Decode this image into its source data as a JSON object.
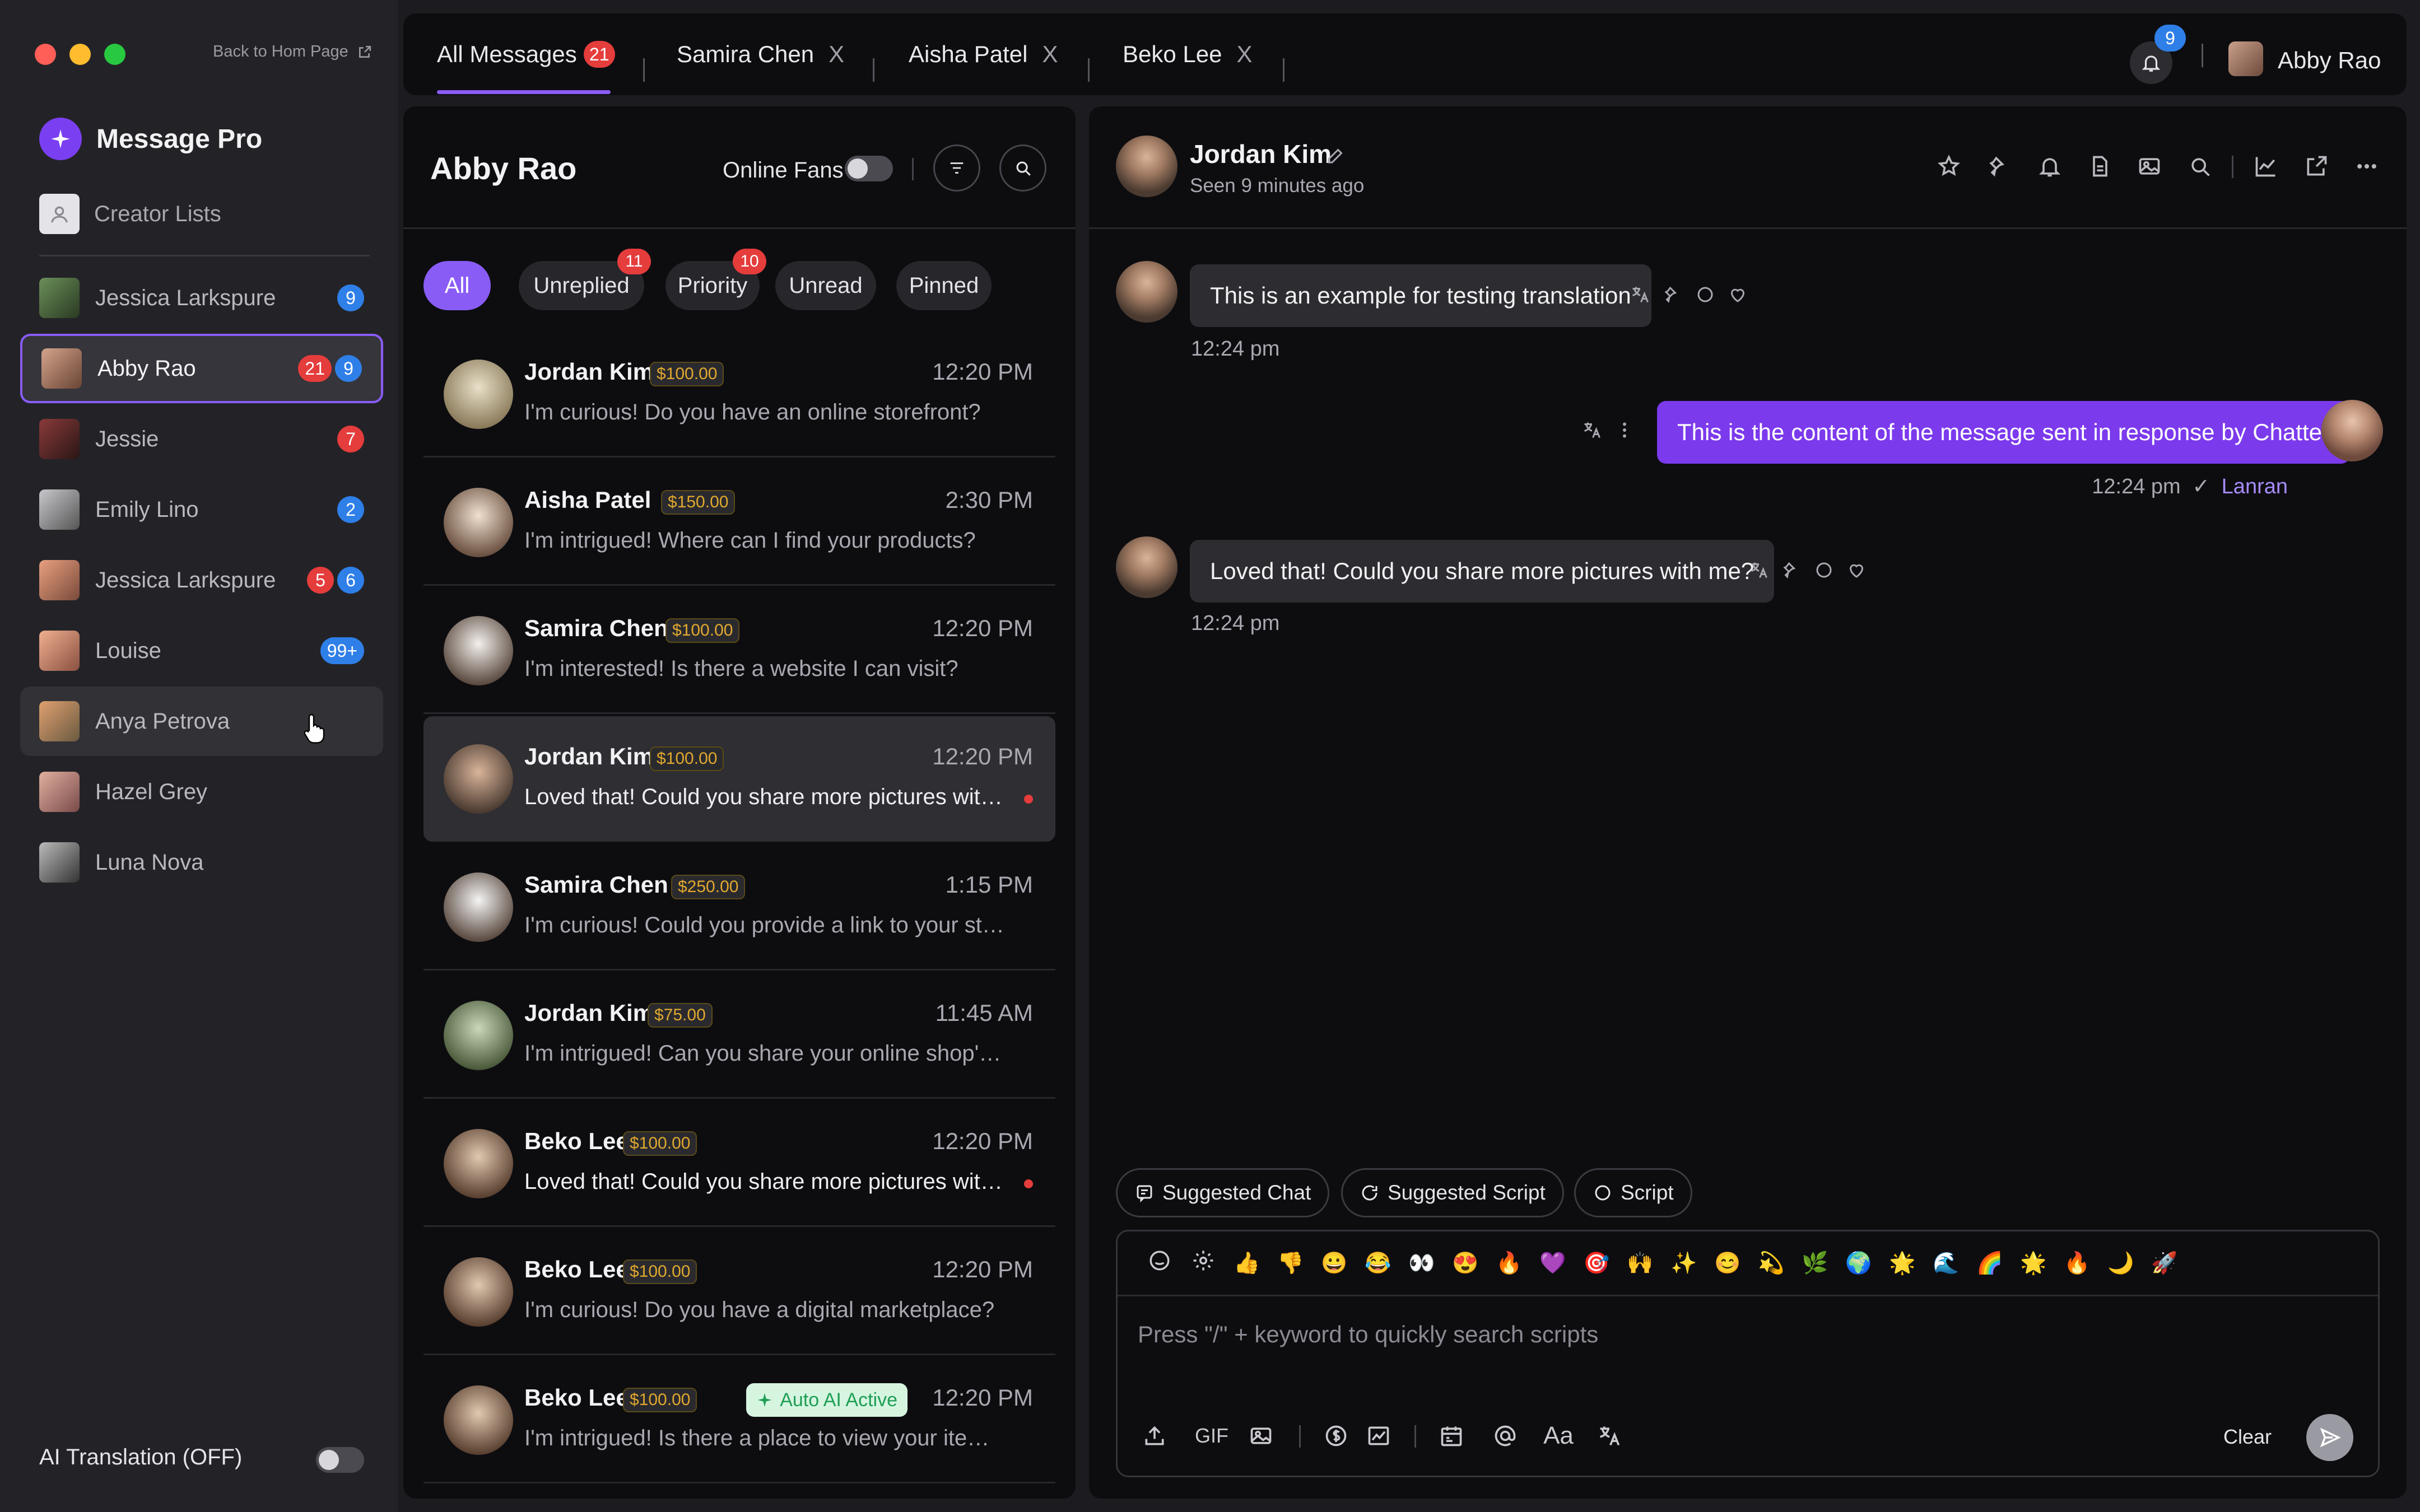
{
  "window": {
    "controls": [
      "close",
      "minimize",
      "maximize"
    ]
  },
  "sidebar": {
    "back_link": "Back to Hom Page",
    "brand": "Message Pro",
    "creator_lists": "Creator Lists",
    "creators": [
      {
        "name": "Jessica Larkspure",
        "badges": [
          {
            "text": "9",
            "color": "blue"
          }
        ]
      },
      {
        "name": "Abby Rao",
        "badges": [
          {
            "text": "21",
            "color": "red"
          },
          {
            "text": "9",
            "color": "blue"
          }
        ],
        "active": true
      },
      {
        "name": "Jessie",
        "badges": [
          {
            "text": "7",
            "color": "red"
          }
        ]
      },
      {
        "name": "Emily Lino",
        "badges": [
          {
            "text": "2",
            "color": "blue"
          }
        ]
      },
      {
        "name": "Jessica Larkspure",
        "badges": [
          {
            "text": "5",
            "color": "red"
          },
          {
            "text": "6",
            "color": "blue"
          }
        ]
      },
      {
        "name": "Louise",
        "badges": [
          {
            "text": "99+",
            "color": "blue"
          }
        ]
      },
      {
        "name": "Anya Petrova",
        "badges": [],
        "hover": true
      },
      {
        "name": "Hazel Grey",
        "badges": []
      },
      {
        "name": "Luna Nova",
        "badges": []
      }
    ],
    "ai_translation": {
      "label": "AI Translation (OFF)",
      "on": false
    }
  },
  "tabs": [
    {
      "label": "All Messages",
      "count": "21",
      "active": true
    },
    {
      "label": "Samira Chen",
      "close": "X"
    },
    {
      "label": "Aisha Patel",
      "close": "X"
    },
    {
      "label": "Beko Lee",
      "close": "X"
    }
  ],
  "notifications": {
    "count": "9"
  },
  "user": {
    "name": "Abby Rao"
  },
  "list": {
    "title": "Abby Rao",
    "online_fans_label": "Online Fans",
    "online_fans_on": false,
    "filters": [
      {
        "label": "All",
        "selected": true
      },
      {
        "label": "Unreplied",
        "count": "11"
      },
      {
        "label": "Priority",
        "count": "10"
      },
      {
        "label": "Unread"
      },
      {
        "label": "Pinned"
      }
    ],
    "conversations": [
      {
        "name": "Jordan Kim",
        "amount": "$100.00",
        "time": "12:20 PM",
        "preview": "I'm curious! Do you have an online storefront?"
      },
      {
        "name": "Aisha Patel",
        "amount": "$150.00",
        "time": "2:30 PM",
        "preview": "I'm intrigued! Where can I find your products?"
      },
      {
        "name": "Samira Chen",
        "amount": "$100.00",
        "time": "12:20 PM",
        "preview": "I'm interested! Is there a website I can visit?"
      },
      {
        "name": "Jordan Kim",
        "amount": "$100.00",
        "time": "12:20 PM",
        "preview": "Loved that! Could you share more pictures with...",
        "unread": true,
        "selected": true
      },
      {
        "name": "Samira Chen",
        "amount": "$250.00",
        "time": "1:15 PM",
        "preview": "I'm curious! Could you provide a link to your store?"
      },
      {
        "name": "Jordan Kim",
        "amount": "$75.00",
        "time": "11:45 AM",
        "preview": "I'm intrigued! Can you share your online shop's UR..."
      },
      {
        "name": "Beko Lee",
        "amount": "$100.00",
        "time": "12:20 PM",
        "preview": "Loved that! Could you share more pictures with...",
        "unread": true
      },
      {
        "name": "Beko Lee",
        "amount": "$100.00",
        "time": "12:20 PM",
        "preview": "I'm curious! Do you have a digital marketplace?"
      },
      {
        "name": "Beko Lee",
        "amount": "$100.00",
        "time": "12:20 PM",
        "preview": "I'm intrigued! Is there a place to view your items?",
        "auto_ai": "Auto AI Active"
      }
    ]
  },
  "chat": {
    "name": "Jordan Kim",
    "seen": "Seen 9 minutes ago",
    "header_icons": [
      "star-icon",
      "pin-icon",
      "bell-icon",
      "document-icon",
      "image-icon",
      "search-icon",
      "chart-icon",
      "external-link-icon",
      "more-icon"
    ],
    "messages": [
      {
        "dir": "in",
        "text": "This is an example for testing translation",
        "time": "12:24 pm"
      },
      {
        "dir": "out",
        "text": "This is the content of the message sent in response by Chatter",
        "time": "12:24 pm",
        "sender": "Lanran",
        "check": "✓"
      },
      {
        "dir": "in",
        "text": "Loved that! Could you share more pictures with me?",
        "time": "12:24 pm"
      }
    ],
    "suggestions": [
      "Suggested Chat",
      "Suggested Script",
      "Script"
    ],
    "emojis": [
      "👍",
      "👎",
      "😀",
      "😂",
      "👀",
      "😍",
      "🔥",
      "💜",
      "🎯",
      "🙌",
      "✨",
      "😊",
      "💫",
      "🌿",
      "🌍",
      "🌟",
      "🌊",
      "🌈",
      "🌟",
      "🔥",
      "🌙",
      "🚀"
    ],
    "placeholder": "Press \"/\" + keyword to quickly search scripts",
    "gif_label": "GIF",
    "font_label": "Aa",
    "clear_label": "Clear"
  },
  "colors": {
    "accent": "#8a5cf6",
    "badge_red": "#e53c3c",
    "badge_blue": "#2f7fe8",
    "amount": "#e0a82e"
  }
}
